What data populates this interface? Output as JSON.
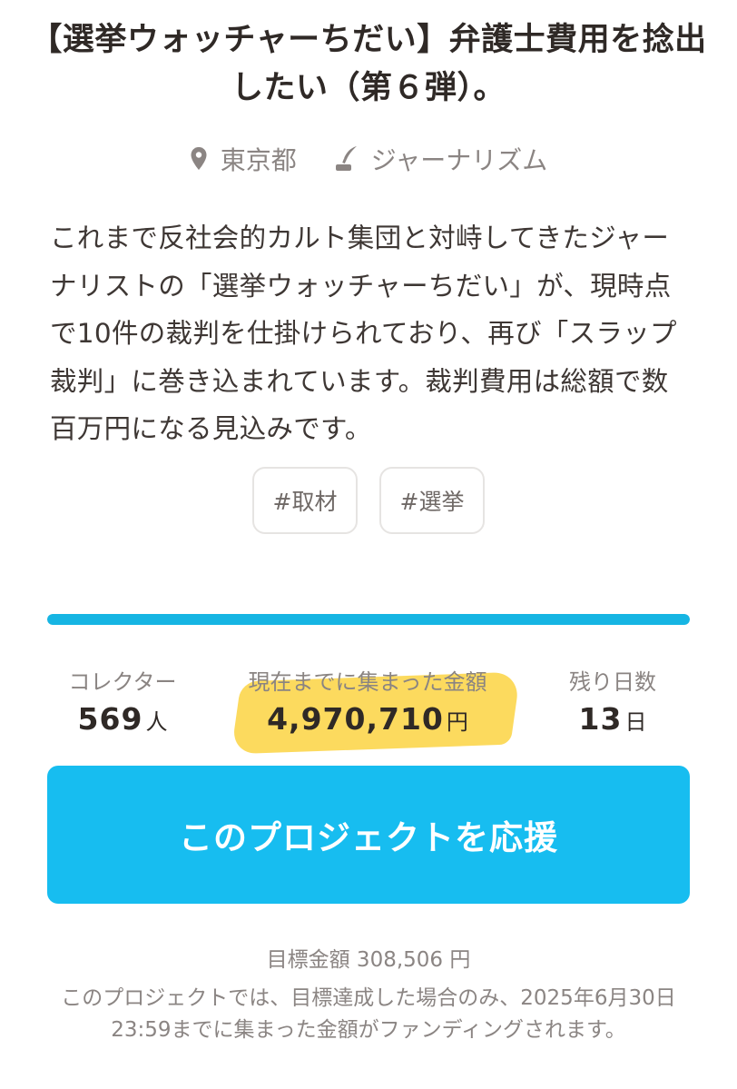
{
  "project": {
    "title": "【選挙ウォッチャーちだい】弁護士費用を捻出したい（第６弾）。",
    "location": "東京都",
    "category": "ジャーナリズム",
    "description": "これまで反社会的カルト集団と対峙してきたジャーナリストの「選挙ウォッチャーちだい」が、現時点で10件の裁判を仕掛けられており、再び「スラップ裁判」に巻き込まれています。裁判費用は総額で数百万円になる見込みです。",
    "tags": [
      "#取材",
      "#選挙"
    ]
  },
  "progress": {
    "percent": 100
  },
  "stats": {
    "collectors_label": "コレクター",
    "collectors_value": "569",
    "collectors_unit": "人",
    "amount_label": "現在までに集まった金額",
    "amount_value": "4,970,710",
    "amount_unit": "円",
    "days_label": "残り日数",
    "days_value": "13",
    "days_unit": "日"
  },
  "actions": {
    "support_label": "このプロジェクトを応援"
  },
  "footer": {
    "target": "目標金額 308,506 円",
    "note": "このプロジェクトでは、目標達成した場合のみ、2025年6月30日23:59までに集まった金額がファンディングされます。"
  },
  "colors": {
    "accent": "#17bdf0",
    "progress": "#16b5e3",
    "highlight": "#fbd23a"
  },
  "icons": {
    "location": "map-pin-icon",
    "category": "quill-pen-icon"
  }
}
